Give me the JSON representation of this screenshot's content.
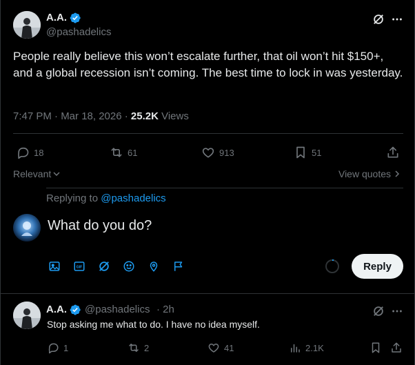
{
  "tweet": {
    "author_name": "A.A.",
    "handle": "@pashadelics",
    "text": "People really believe this won’t escalate further, that oil won’t hit $150+, and a global recession isn’t coming. The best time to lock in was yesterday.",
    "time": "7:47 PM · Mar 18, 2026 · ",
    "views_count": "25.2K",
    "views_label": " Views",
    "stats": {
      "replies": "18",
      "reposts": "61",
      "likes": "913",
      "bookmarks": "51"
    }
  },
  "sort": {
    "relevant_label": "Relevant",
    "view_quotes_label": "View quotes"
  },
  "compose": {
    "replying_prefix": "Replying to ",
    "replying_handle": "@pashadelics",
    "input_value": "What do you do?",
    "reply_button": "Reply"
  },
  "reply": {
    "author_name": "A.A.",
    "handle": "@pashadelics",
    "age": "· 2h",
    "text": "Stop asking me what to do. I have no idea myself.",
    "stats": {
      "replies": "1",
      "reposts": "2",
      "likes": "41",
      "views": "2.1K"
    }
  },
  "colors": {
    "background": "#000000",
    "text": "#e7e9ea",
    "muted": "#71767b",
    "accent": "#1d9bf0",
    "divider": "#2f3336"
  }
}
